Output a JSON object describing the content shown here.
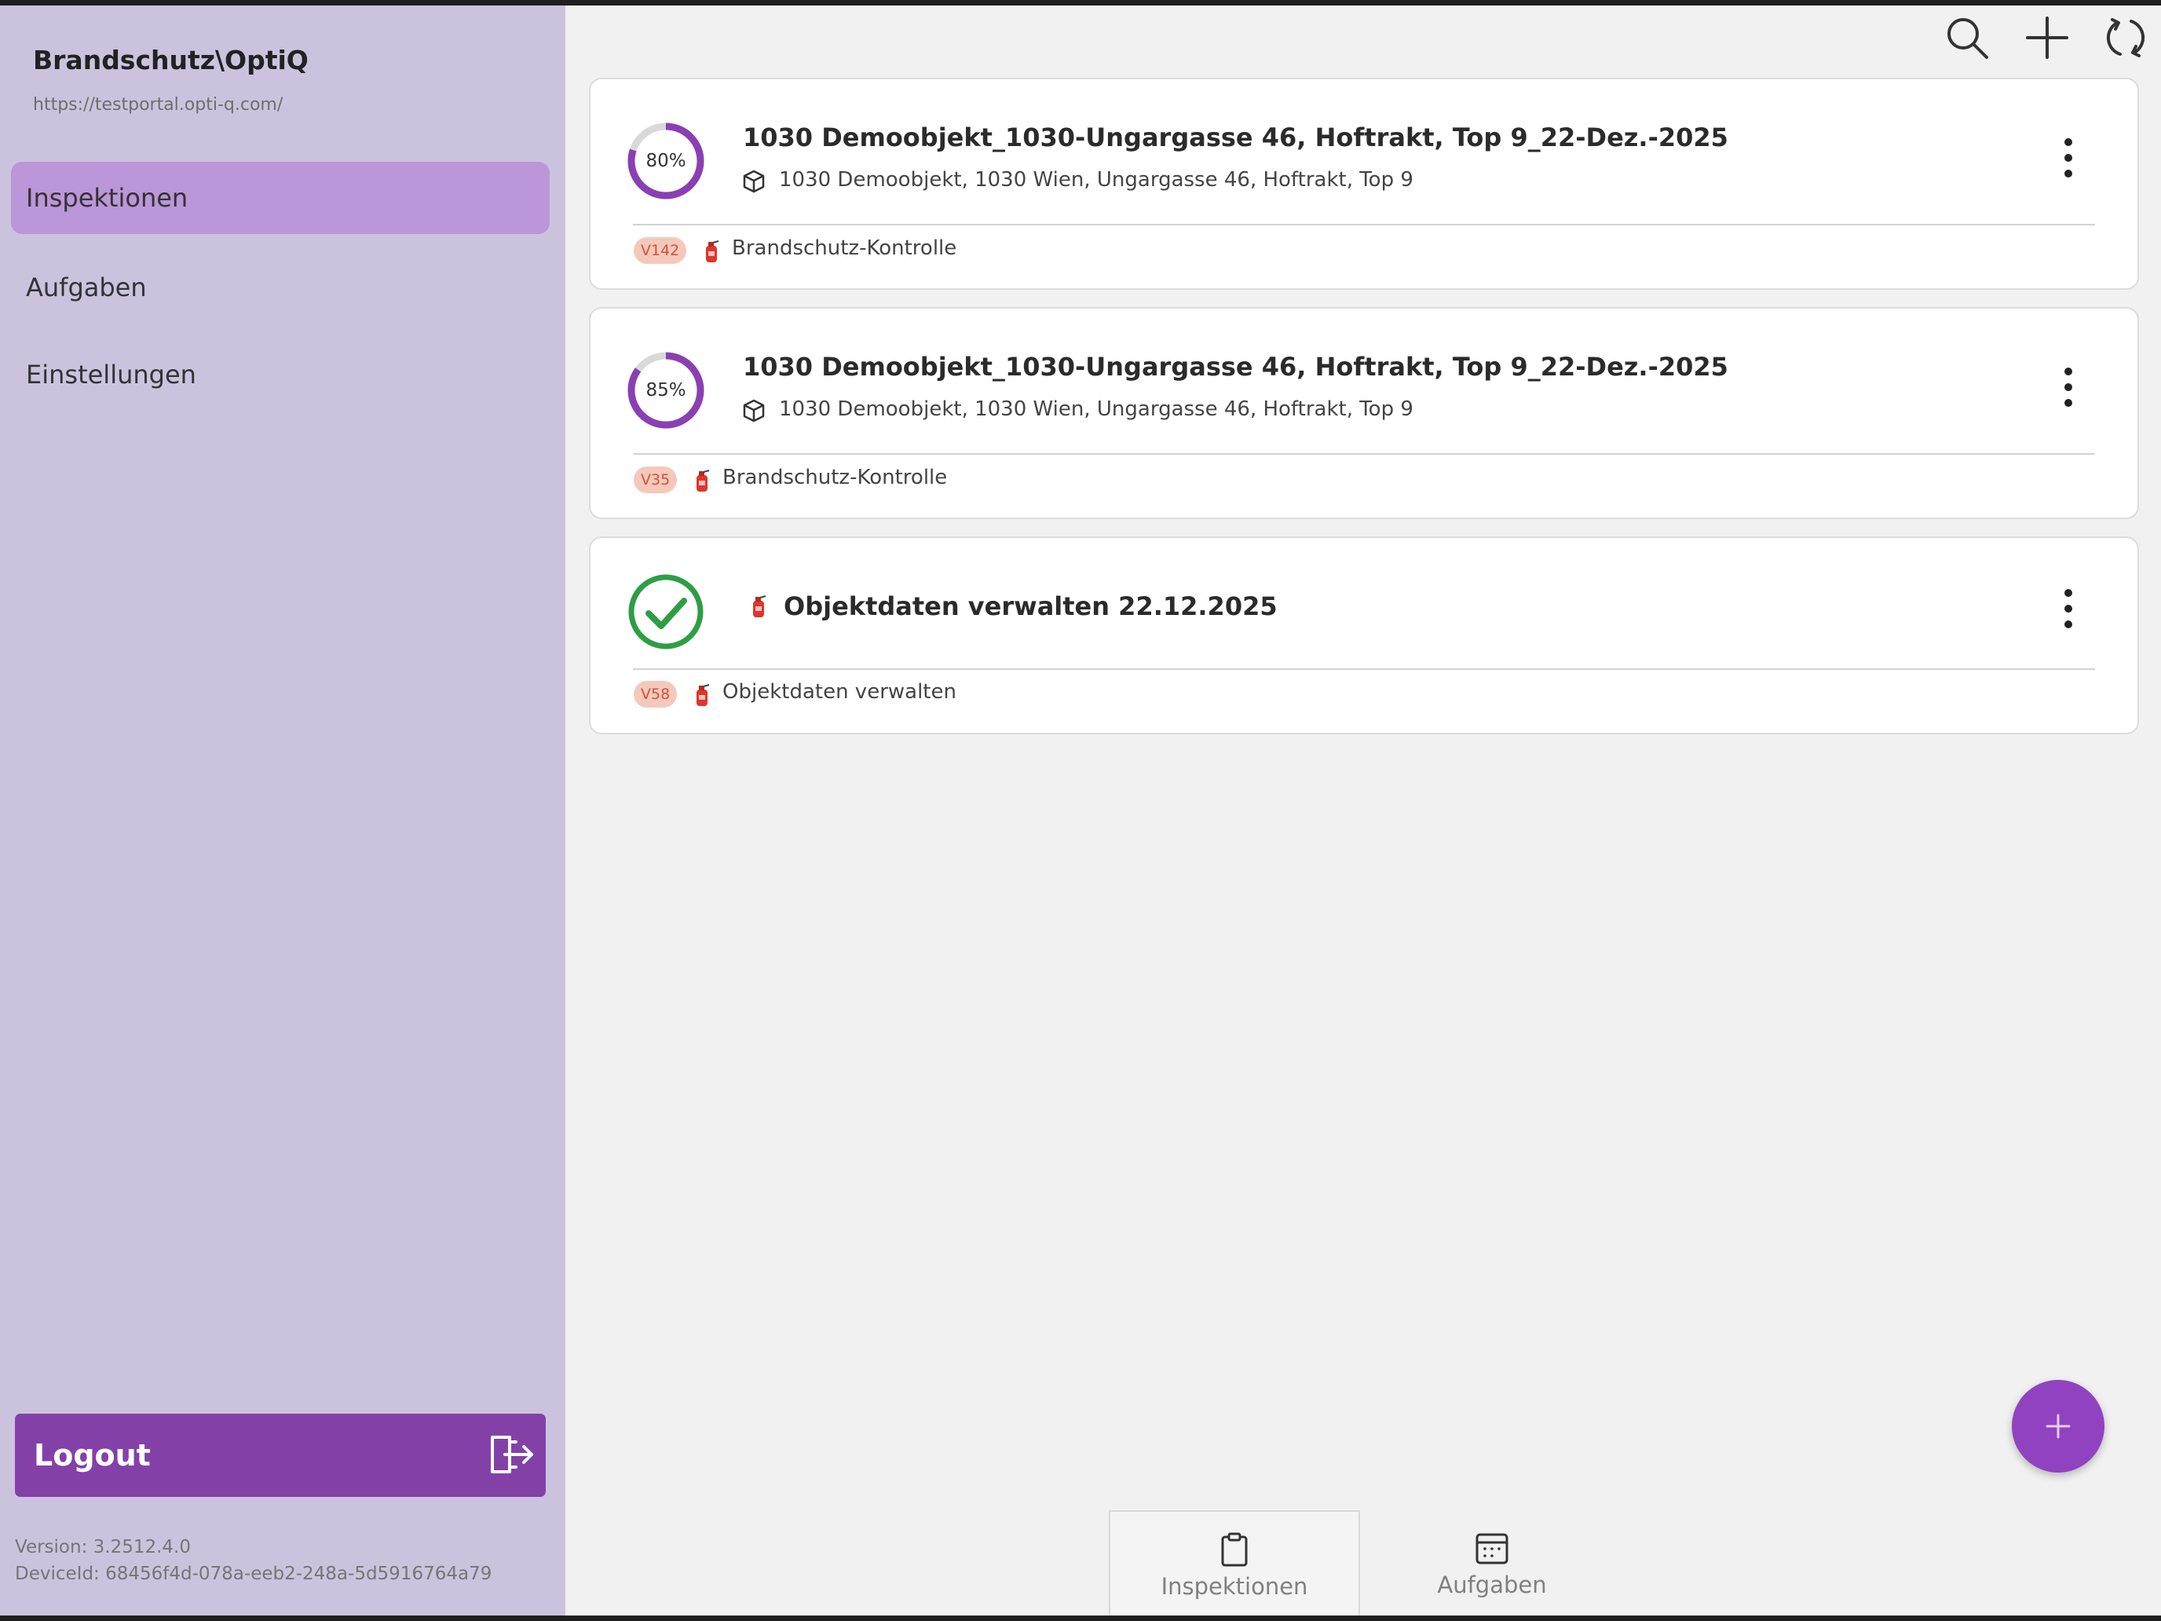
{
  "app": {
    "title": "Brandschutz\\OptiQ",
    "url": "https://testportal.opti-q.com/"
  },
  "sidebar": {
    "items": [
      {
        "label": "Inspektionen",
        "active": true
      },
      {
        "label": "Aufgaben",
        "active": false
      },
      {
        "label": "Einstellungen",
        "active": false
      }
    ],
    "logout_label": "Logout",
    "version_text": "Version:  3.2512.4.0",
    "device_text": "DeviceId:  68456f4d-078a-eeb2-248a-5d5916764a79"
  },
  "toolbar": {
    "icons": [
      "search-icon",
      "plus-icon",
      "sync-icon"
    ]
  },
  "inspections": [
    {
      "progress_label": "80%",
      "progress": 0.8,
      "title": "1030 Demoobjekt_1030-Ungargasse 46, Hoftrakt, Top 9_22-Dez.-2025",
      "address": "1030 Demoobjekt, 1030 Wien, Ungargasse 46, Hoftrakt, Top 9",
      "badge": "V142",
      "type": "Brandschutz-Kontrolle"
    },
    {
      "progress_label": "85%",
      "progress": 0.85,
      "title": "1030 Demoobjekt_1030-Ungargasse 46, Hoftrakt, Top 9_22-Dez.-2025",
      "address": "1030 Demoobjekt, 1030 Wien, Ungargasse 46, Hoftrakt, Top 9",
      "badge": "V35",
      "type": "Brandschutz-Kontrolle"
    },
    {
      "status": "completed",
      "title": "Objektdaten verwalten 22.12.2025",
      "badge": "V58",
      "type": "Objektdaten verwalten"
    }
  ],
  "bottom_nav": [
    {
      "label": "Inspektionen",
      "icon": "clipboard-icon",
      "active": true
    },
    {
      "label": "Aufgaben",
      "icon": "calendar-icon",
      "active": false
    }
  ],
  "colors": {
    "sidebar_bg": "#cbc3de",
    "nav_active": "#bb96d9",
    "logout_bg": "#8341a8",
    "fab": "#9142c0",
    "ring": "#8a3fb3",
    "check": "#2e9e44",
    "badge_bg": "#f4c9bb",
    "badge_text": "#d0533b"
  }
}
